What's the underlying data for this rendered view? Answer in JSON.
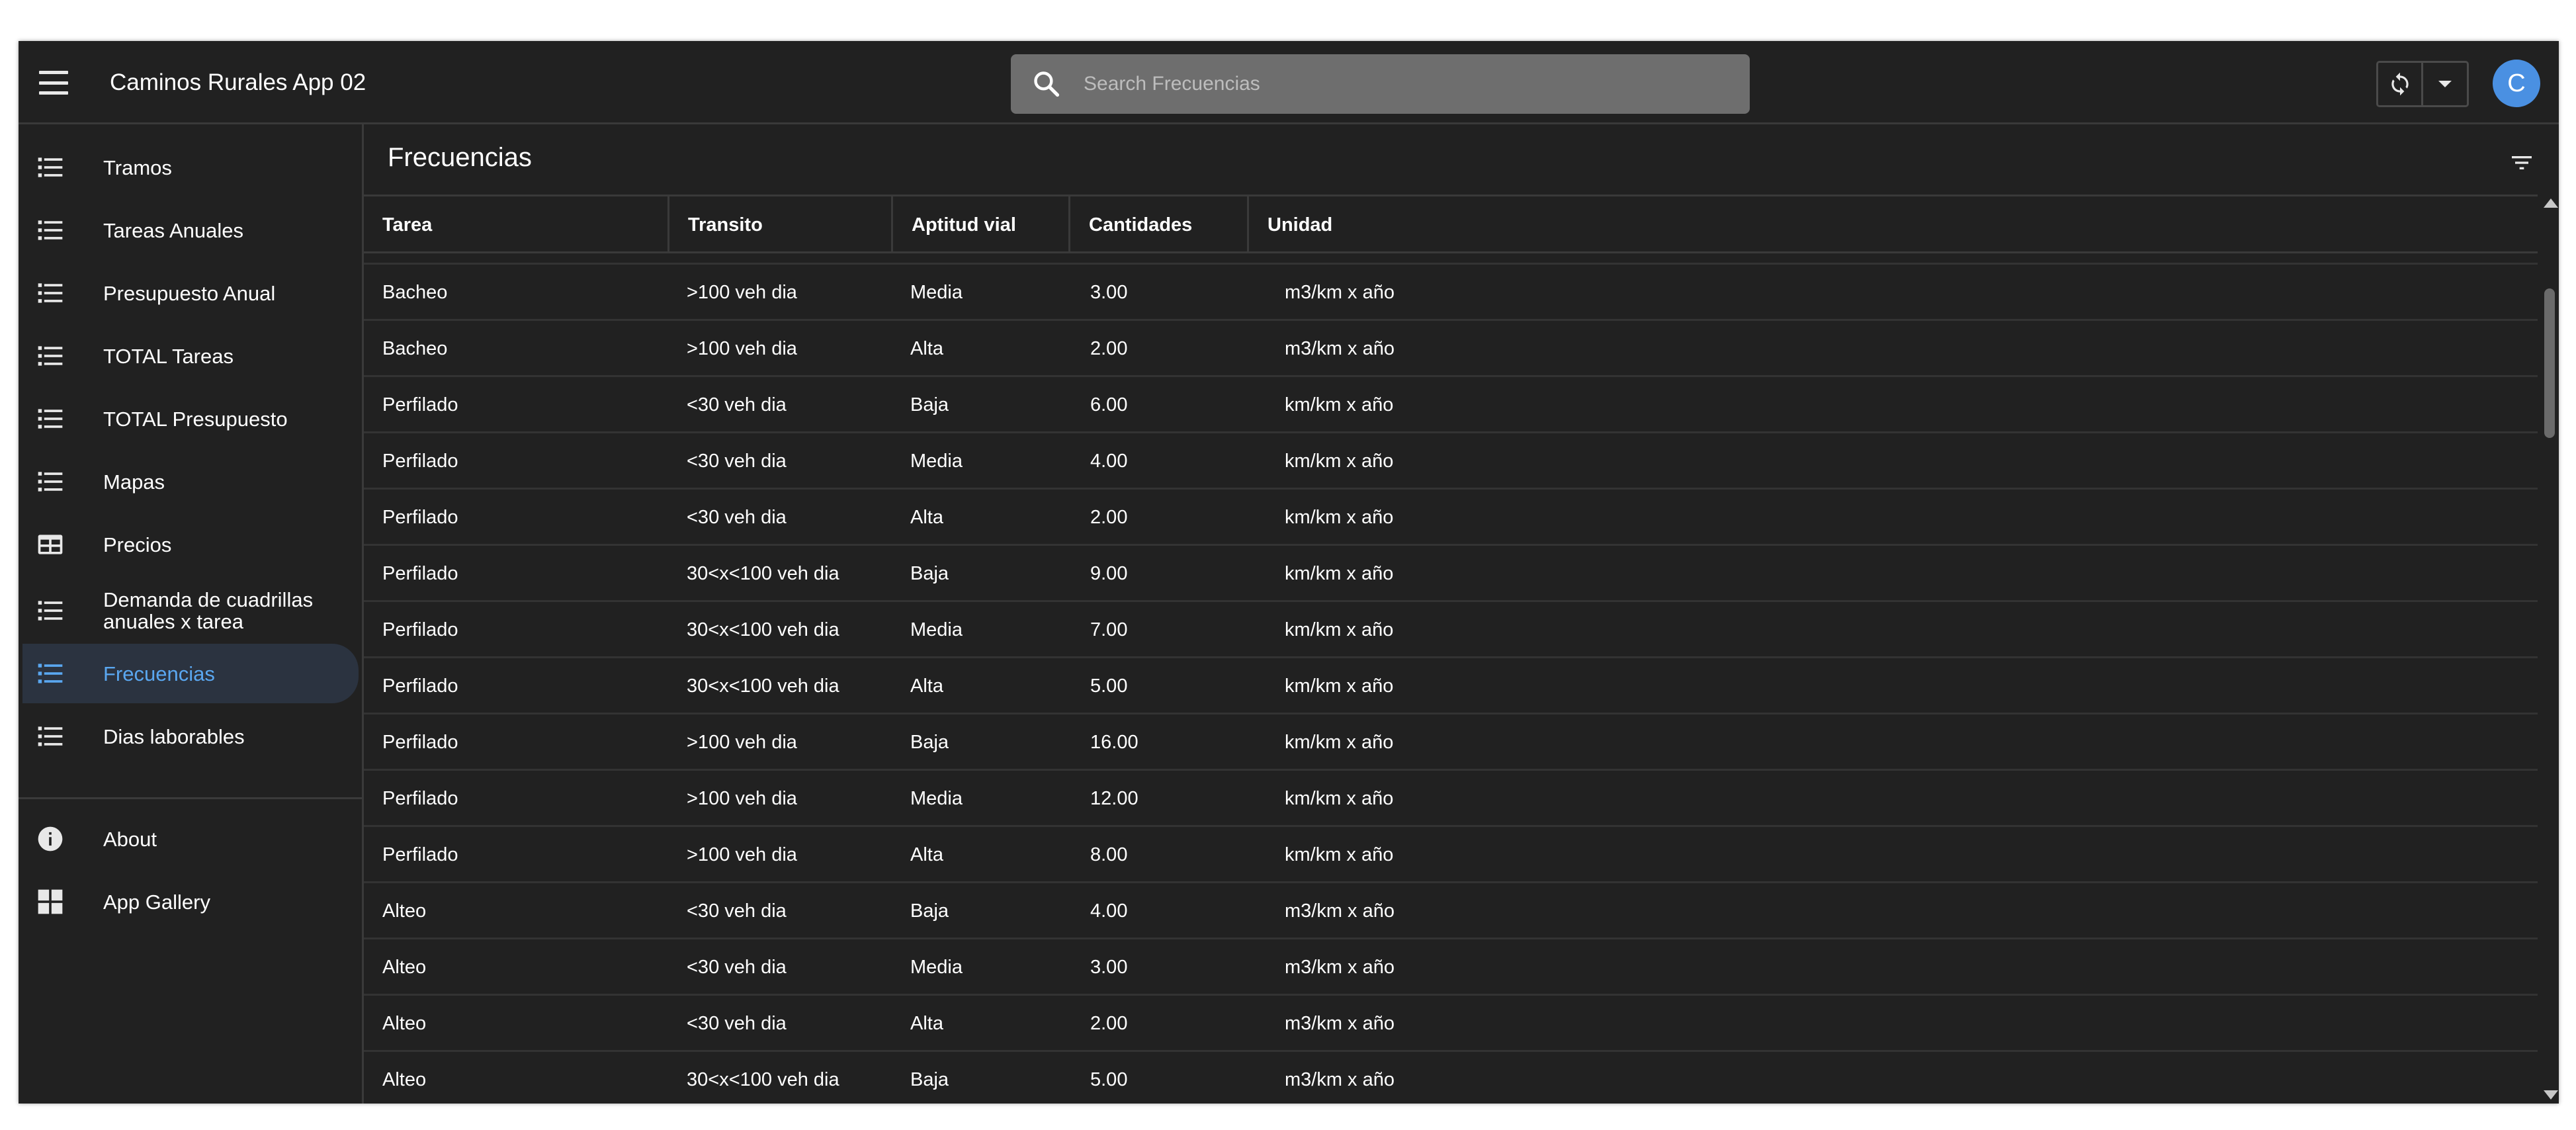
{
  "header": {
    "title": "Caminos Rurales App 02",
    "search_placeholder": "Search Frecuencias",
    "avatar_letter": "C"
  },
  "sidebar": {
    "items": [
      {
        "label": "Tramos",
        "icon": "list-icon"
      },
      {
        "label": "Tareas Anuales",
        "icon": "list-icon"
      },
      {
        "label": "Presupuesto Anual",
        "icon": "list-icon"
      },
      {
        "label": "TOTAL Tareas",
        "icon": "list-icon"
      },
      {
        "label": "TOTAL Presupuesto",
        "icon": "list-icon"
      },
      {
        "label": "Mapas",
        "icon": "list-icon"
      },
      {
        "label": "Precios",
        "icon": "table-icon"
      },
      {
        "label": "Demanda de cuadrillas anuales x tarea",
        "icon": "list-icon"
      },
      {
        "label": "Frecuencias",
        "icon": "list-icon",
        "active": true
      },
      {
        "label": "Dias laborables",
        "icon": "list-icon"
      }
    ],
    "footer_items": [
      {
        "label": "About",
        "icon": "info-icon"
      },
      {
        "label": "App Gallery",
        "icon": "grid-icon"
      }
    ]
  },
  "main": {
    "title": "Frecuencias",
    "columns": [
      "Tarea",
      "Transito",
      "Aptitud vial",
      "Cantidades",
      "Unidad"
    ],
    "rows": [
      [
        "Bacheo",
        ">100 veh dia",
        "Media",
        "3.00",
        "m3/km x año"
      ],
      [
        "Bacheo",
        ">100 veh dia",
        "Alta",
        "2.00",
        "m3/km x año"
      ],
      [
        "Perfilado",
        "<30 veh dia",
        "Baja",
        "6.00",
        "km/km x año"
      ],
      [
        "Perfilado",
        "<30 veh dia",
        "Media",
        "4.00",
        "km/km x año"
      ],
      [
        "Perfilado",
        "<30 veh dia",
        "Alta",
        "2.00",
        "km/km x año"
      ],
      [
        "Perfilado",
        "30<x<100 veh dia",
        "Baja",
        "9.00",
        "km/km x año"
      ],
      [
        "Perfilado",
        "30<x<100 veh dia",
        "Media",
        "7.00",
        "km/km x año"
      ],
      [
        "Perfilado",
        "30<x<100 veh dia",
        "Alta",
        "5.00",
        "km/km x año"
      ],
      [
        "Perfilado",
        ">100 veh dia",
        "Baja",
        "16.00",
        "km/km x año"
      ],
      [
        "Perfilado",
        ">100 veh dia",
        "Media",
        "12.00",
        "km/km x año"
      ],
      [
        "Perfilado",
        ">100 veh dia",
        "Alta",
        "8.00",
        "km/km x año"
      ],
      [
        "Alteo",
        "<30 veh dia",
        "Baja",
        "4.00",
        "m3/km x año"
      ],
      [
        "Alteo",
        "<30 veh dia",
        "Media",
        "3.00",
        "m3/km x año"
      ],
      [
        "Alteo",
        "<30 veh dia",
        "Alta",
        "2.00",
        "m3/km x año"
      ],
      [
        "Alteo",
        "30<x<100 veh dia",
        "Baja",
        "5.00",
        "m3/km x año"
      ]
    ]
  },
  "colors": {
    "background": "#212121",
    "accent": "#5aa7f0",
    "avatar": "#4a90e2",
    "search_bg": "#6e6e6e"
  }
}
